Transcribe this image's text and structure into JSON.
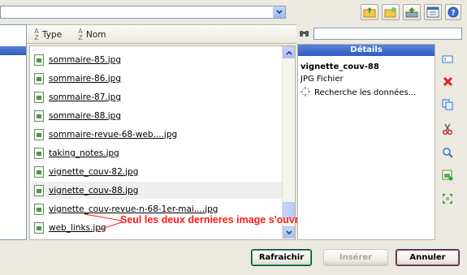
{
  "header": {
    "path_value": ""
  },
  "toolbar": {
    "icons": [
      "folder-up-icon",
      "new-folder-icon",
      "upload-icon",
      "view-mode-icon",
      "help-icon"
    ]
  },
  "columns": {
    "type_label": "Type",
    "name_label": "Nom"
  },
  "files": [
    {
      "name": "sommaire-85.jpg",
      "selected": false
    },
    {
      "name": "sommaire-86.jpg",
      "selected": false
    },
    {
      "name": "sommaire-87.jpg",
      "selected": false
    },
    {
      "name": "sommaire-88.jpg",
      "selected": false
    },
    {
      "name": "sommaire-revue-68-web....jpg",
      "selected": false
    },
    {
      "name": "taking_notes.jpg",
      "selected": false
    },
    {
      "name": "vignette_couv-82.jpg",
      "selected": false
    },
    {
      "name": "vignette_couv-88.jpg",
      "selected": true
    },
    {
      "name": "vignette_couv-revue-n-68-1er-mai....jpg",
      "selected": false
    },
    {
      "name": "web_links.jpg",
      "selected": false
    }
  ],
  "search": {
    "value": ""
  },
  "details": {
    "title": "Détails",
    "file_name": "vignette_couv-88",
    "file_type": "JPG Fichier",
    "loading_text": "Recherche les données..."
  },
  "side_actions": [
    "rename-icon",
    "delete-icon",
    "copy-icon",
    "cut-icon",
    "zoom-icon",
    "insert-image-icon",
    "resize-icon"
  ],
  "buttons": {
    "refresh": "Rafraichir",
    "insert": "Insérer",
    "cancel": "Annuler"
  },
  "annotation": "Seul les deux dernieres image s'ouvrent",
  "colors": {
    "accent": "#2b5cc0",
    "annotation": "#ff1a1a",
    "window_bg": "#ebe9e0"
  }
}
